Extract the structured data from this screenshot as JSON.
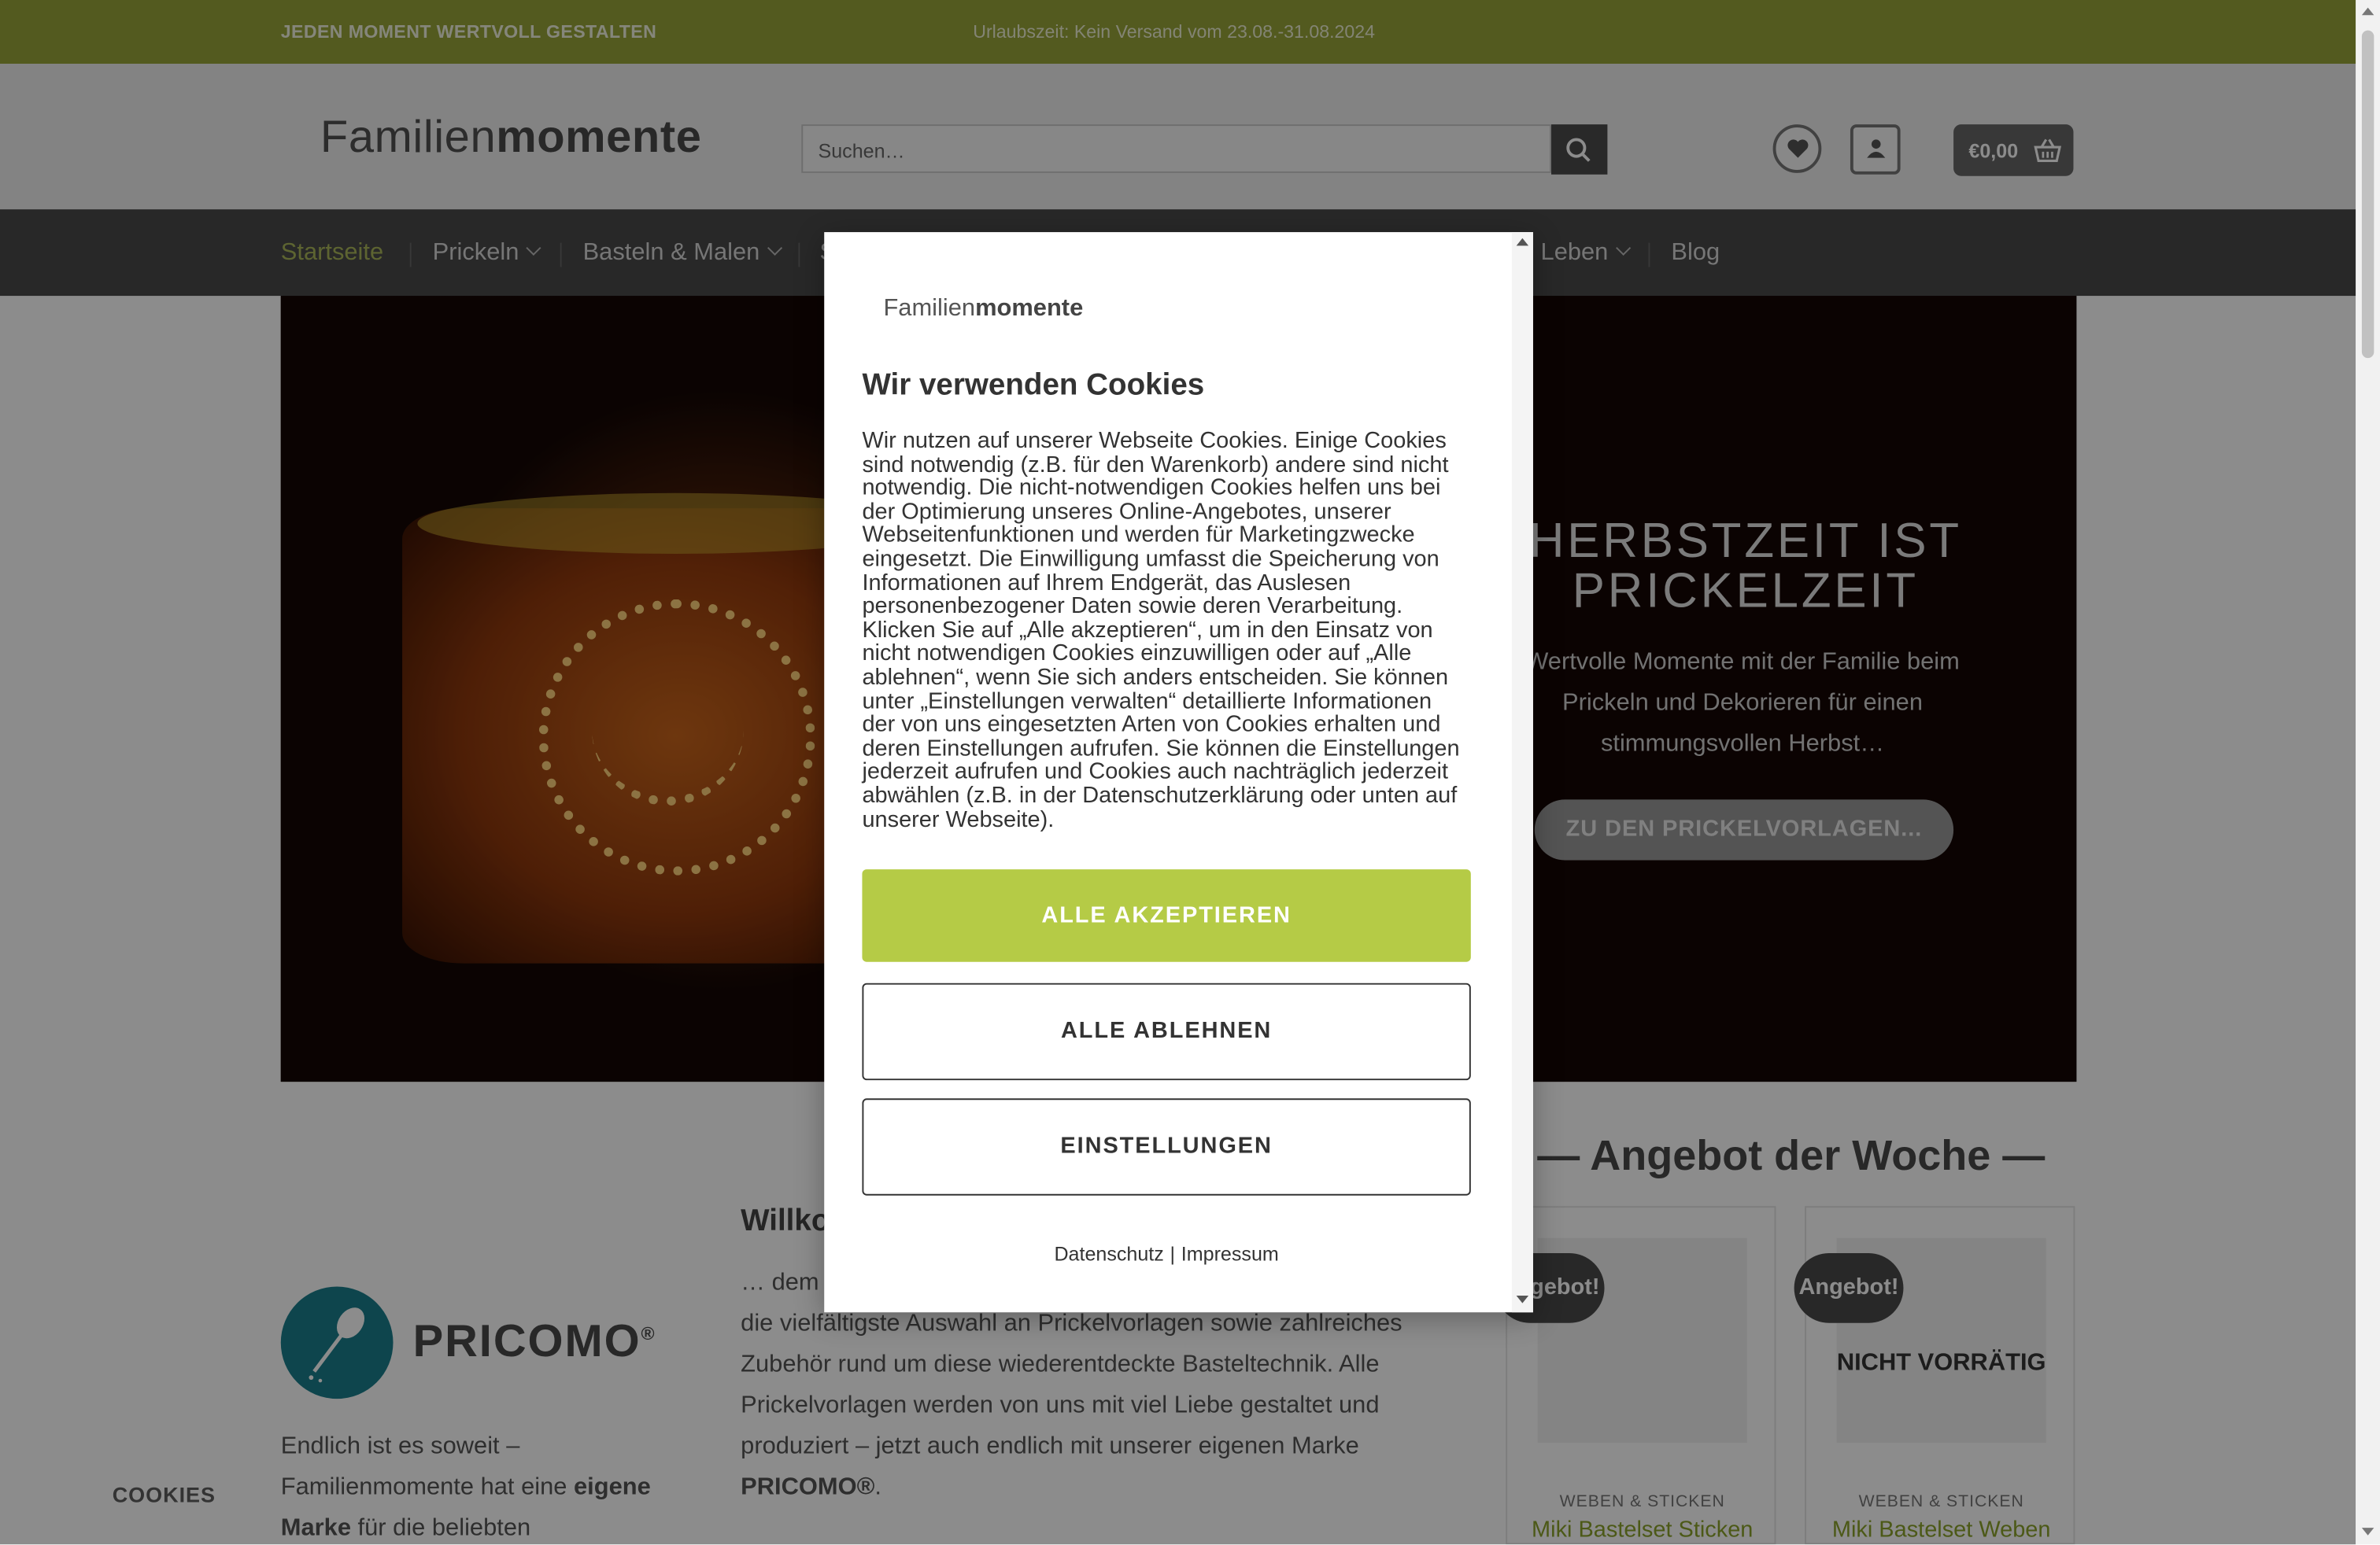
{
  "topbar": {
    "slogan": "JEDEN MOMENT WERTVOLL GESTALTEN",
    "notice": "Urlaubszeit: Kein Versand vom 23.08.-31.08.2024"
  },
  "header": {
    "logo_regular": "Familien",
    "logo_bold": "momente",
    "search_placeholder": "Suchen…",
    "cart_total": "€0,00"
  },
  "nav": {
    "items": [
      {
        "label": "Startseite",
        "active": true
      },
      {
        "label": "Prickeln",
        "has_submenu": true
      },
      {
        "label": "Basteln & Malen",
        "has_submenu": true
      },
      {
        "label": "S"
      },
      {
        "label": "Leben",
        "has_submenu": true
      },
      {
        "label": "Blog"
      }
    ]
  },
  "hero": {
    "title": "HERBSTZEIT IST PRICKELZEIT",
    "text": "Wertvolle Momente mit der Familie beim Prickeln und Dekorieren für einen stimmungsvollen Herbst…",
    "button": "ZU DEN PRICKELVORLAGEN..."
  },
  "brand": {
    "name": "PRICOMO",
    "reg": "®",
    "intro_pre": "Endlich ist es soweit – Familienmomente hat eine ",
    "intro_bold": "eigene Marke",
    "intro_post": " für die beliebten"
  },
  "welcome": {
    "title": "Willko",
    "text_pre": "… dem f",
    "text_lines": "die vielfältigste Auswahl an Prickelvorlagen sowie zahlreiches Zubehör rund um diese wiederentdeckte Basteltechnik. Alle Prickelvorlagen werden von uns mit viel Liebe gestaltet und produziert – jetzt auch endlich mit unserer eigenen Marke ",
    "text_bold": "PRICOMO®",
    "text_end": "."
  },
  "offers": {
    "title": "— Angebot der Woche —",
    "products": [
      {
        "badge": "Angebot!",
        "category": "WEBEN & STICKEN",
        "name": "Miki Bastelset Sticken",
        "stock": ""
      },
      {
        "badge": "Angebot!",
        "category": "WEBEN & STICKEN",
        "name": "Miki Bastelset Weben",
        "stock": "NICHT VORRÄTIG"
      }
    ]
  },
  "cookie_tab": "COOKIES",
  "cookie_modal": {
    "logo_regular": "Familien",
    "logo_bold": "momente",
    "title": "Wir verwenden Cookies",
    "body": "Wir nutzen auf unserer Webseite Cookies. Einige Cookies sind notwendig (z.B. für den Warenkorb) andere sind nicht notwendig. Die nicht-notwendigen Cookies helfen uns bei der Optimierung unseres Online-Angebotes, unserer Webseitenfunktionen und werden für Marketingzwecke eingesetzt. Die Einwilligung umfasst die Speicherung von Informationen auf Ihrem Endgerät, das Auslesen personenbezogener Daten sowie deren Verarbeitung. Klicken Sie auf „Alle akzeptieren“, um in den Einsatz von nicht notwendigen Cookies einzuwilligen oder auf „Alle ablehnen“, wenn Sie sich anders entscheiden. Sie können unter „Einstellungen verwalten“ detaillierte Informationen der von uns eingesetzten Arten von Cookies erhalten und deren Einstellungen aufrufen. Sie können die Einstellungen jederzeit aufrufen und Cookies auch nachträglich jederzeit abwählen (z.B. in der Datenschutzerklärung oder unten auf unserer Webseite).",
    "accept": "ALLE AKZEPTIEREN",
    "reject": "ALLE ABLEHNEN",
    "settings": "EINSTELLUNGEN",
    "link_privacy": "Datenschutz",
    "link_separator": "|",
    "link_imprint": "Impressum"
  },
  "colors": {
    "topbar": "#98a43a",
    "accent_green": "#b5cb46",
    "nav_bg": "#4a4a4a",
    "brand_teal": "#1a7f8c"
  },
  "icons": [
    "search-icon",
    "heart-icon",
    "user-icon",
    "basket-icon",
    "chevron-down-icon",
    "needle-icon"
  ]
}
